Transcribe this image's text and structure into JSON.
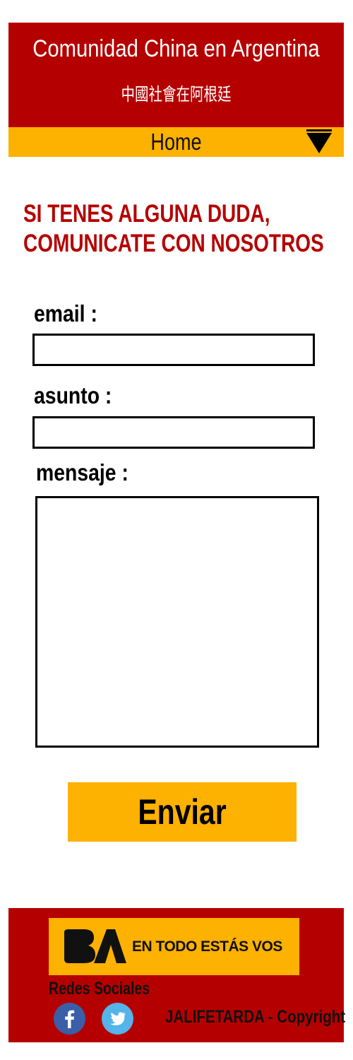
{
  "header": {
    "title": "Comunidad China en Argentina",
    "subtitle": "中國社會在阿根廷"
  },
  "nav": {
    "current": "Home",
    "dropdown_icon": "triangle-down-icon"
  },
  "contact": {
    "heading_line1": "SI TENES ALGUNA DUDA,",
    "heading_line2": "COMUNICATE CON NOSOTROS",
    "email_label": "email :",
    "email_value": "",
    "subject_label": "asunto :",
    "subject_value": "",
    "message_label": "mensaje :",
    "message_value": "",
    "send_label": "Enviar"
  },
  "footer": {
    "banner_logo": "BA",
    "banner_text": "EN TODO ESTÁS VOS",
    "social_title": "Redes Sociales",
    "social_icons": [
      "facebook-icon",
      "twitter-icon"
    ],
    "copyright": "JALIFETARDA - Copyright"
  },
  "colors": {
    "brand_red": "#b50000",
    "accent_yellow": "#fdb100",
    "facebook_blue": "#3b5ea8",
    "twitter_blue": "#55b4ea"
  }
}
